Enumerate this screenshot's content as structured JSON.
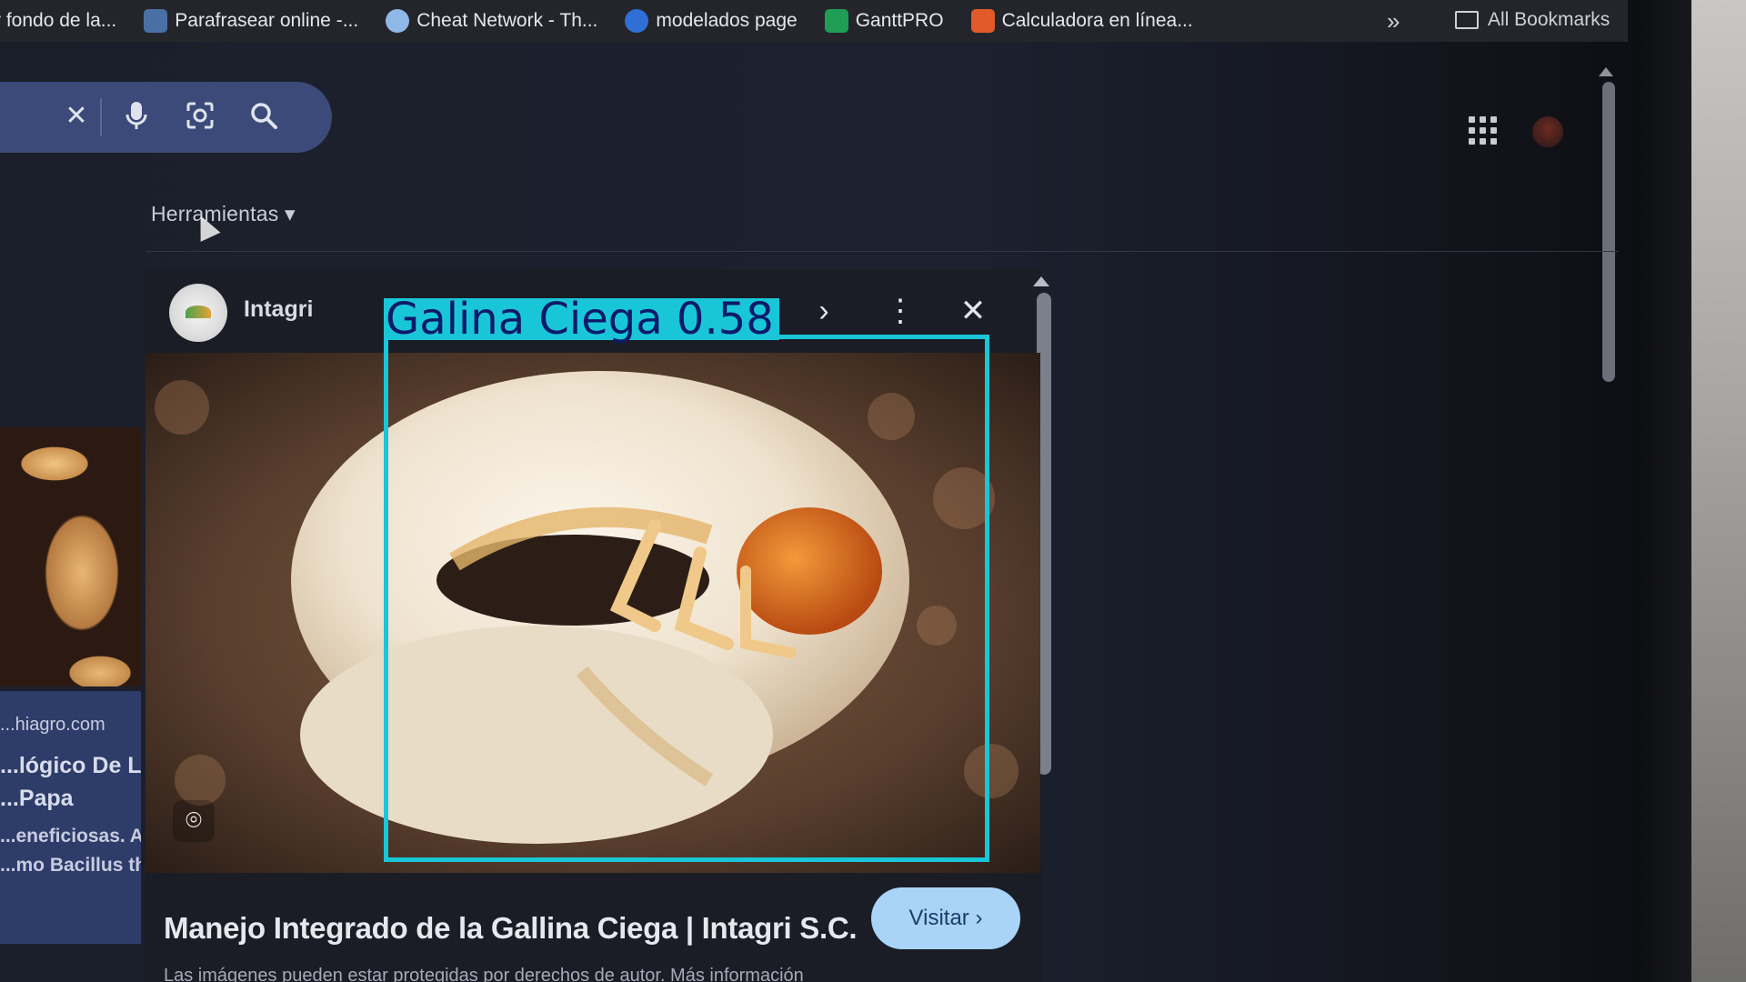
{
  "bookmarks": [
    {
      "label": "r fondo de la...",
      "color": "#6b7280"
    },
    {
      "label": "Parafrasear online -...",
      "color": "#4a6fa5"
    },
    {
      "label": "Cheat Network - Th...",
      "color": "#8fb7e8"
    },
    {
      "label": "modelados page",
      "color": "#2f6fd6"
    },
    {
      "label": "GanttPRO",
      "color": "#1f9d55"
    },
    {
      "label": "Calculadora en línea...",
      "color": "#e05a2a"
    }
  ],
  "bookmarks_more": "»",
  "all_bookmarks": "All Bookmarks",
  "search": {
    "clear_icon": "close-icon",
    "voice_icon": "microphone-icon",
    "lens_icon": "lens-icon",
    "search_icon": "search-icon"
  },
  "tools_label": "Herramientas ▾",
  "left_strip": {
    "domain": "...hiagro.com",
    "title_line1": "...lógico De La C",
    "title_line2": "...Papa",
    "snippet_line1": "...eneficiosas. Algu",
    "snippet_line2": "...mo Bacillus thur"
  },
  "preview": {
    "source": "Intagri",
    "title": "Manejo Integrado de la Gallina Ciega | Intagri S.C.",
    "visit_label": "Visitar ›",
    "copyright": "Las imágenes pueden estar protegidas por derechos de autor. Más información",
    "next_icon": "›",
    "more_icon": "⋮",
    "close_icon": "✕"
  },
  "detection": {
    "label": "Galina Ciega 0.58",
    "color": "#19c6d8"
  }
}
